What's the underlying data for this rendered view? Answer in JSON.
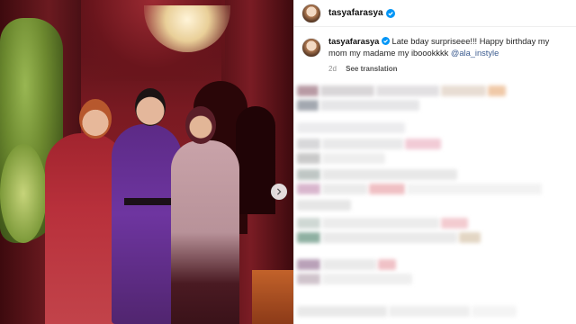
{
  "post": {
    "username": "tasyafarasya",
    "caption_username": "tasyafarasya",
    "caption_text": "Late bday surpriseee!!! Happy birthday my mom my madame my iboookkkk",
    "caption_mention": "@ala_instyle",
    "time_ago": "2d",
    "see_translation": "See translation"
  },
  "icons": {
    "verified": "verified-badge-icon",
    "next": "chevron-right-icon"
  },
  "colors": {
    "verified_blue": "#0095f6",
    "mention": "#3b5b8f",
    "muted": "#8e8e8e"
  }
}
